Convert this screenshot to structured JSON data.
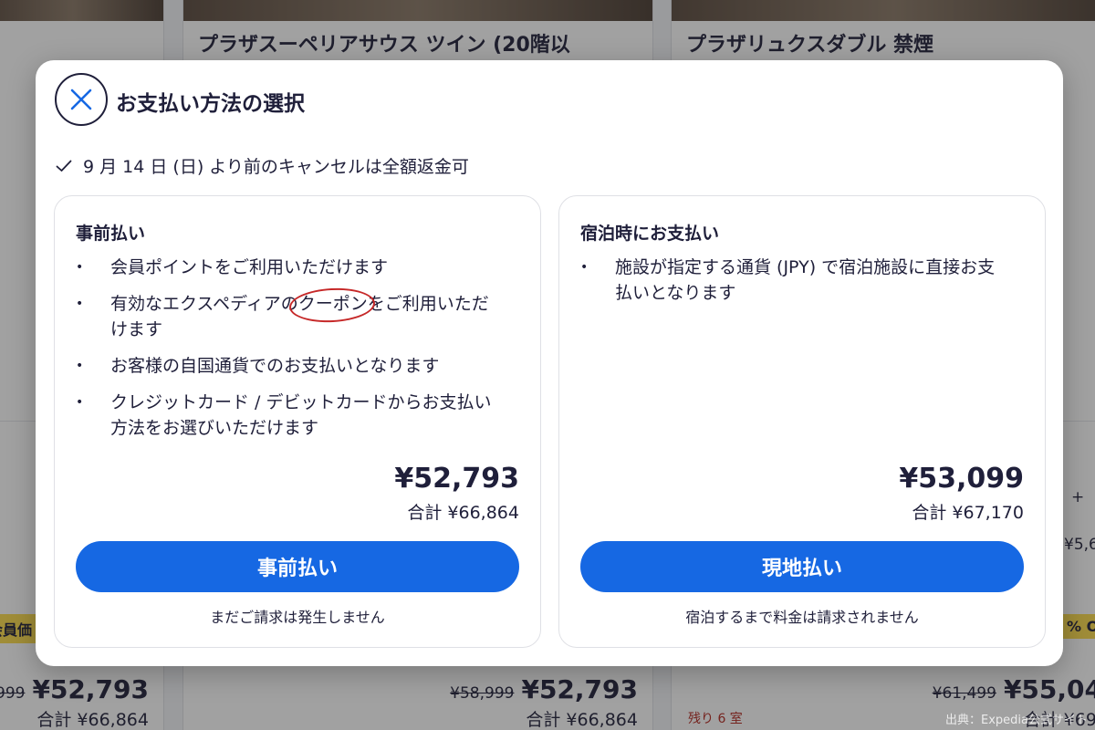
{
  "background": {
    "cards": [
      {
        "badge": "会員価",
        "old_price": "999",
        "price": "¥52,793",
        "total": "合計 ¥66,864"
      },
      {
        "title": "プラザスーペリアサウス ツイン (20階以",
        "old_price": "¥58,999",
        "price": "¥52,793",
        "total": "合計 ¥66,864"
      },
      {
        "title": "プラザリュクスダブル 禁煙",
        "badge": "% O",
        "old_price": "¥61,499",
        "price": "¥55,04",
        "total": "合計 ¥69,",
        "rooms_left": "残り 6 室",
        "side_plus": "+ ",
        "side_price": "¥5,6"
      }
    ],
    "credit": "出典：Expedia公式サイト"
  },
  "dialog": {
    "title": "お支払い方法の選択",
    "cancellation": "9 月 14 日 (日) より前のキャンセルは全額返金可",
    "options": [
      {
        "title": "事前払い",
        "bullets": [
          "会員ポイントをご利用いただけます",
          "有効なエクスペディアの",
          "お客様の自国通貨でのお支払いとなります",
          "クレジットカード / デビットカードからお支払い方法をお選びいただけます"
        ],
        "coupon_text": "クーポン",
        "coupon_suffix": "をご利用いただけます",
        "price": "¥52,793",
        "total": "合計 ¥66,864",
        "button": "事前払い",
        "note": "まだご請求は発生しません"
      },
      {
        "title": "宿泊時にお支払い",
        "bullets": [
          "施設が指定する通貨 (JPY) で宿泊施設に直接お支払いとなります"
        ],
        "price": "¥53,099",
        "total": "合計 ¥67,170",
        "button": "現地払い",
        "note": "宿泊するまで料金は請求されません"
      }
    ]
  },
  "colors": {
    "primary": "#1668e3",
    "text": "#1f1f3a",
    "badge": "#fedc4a",
    "annotation": "#c62828"
  },
  "icons": [
    "close-icon",
    "checkmark-icon"
  ]
}
